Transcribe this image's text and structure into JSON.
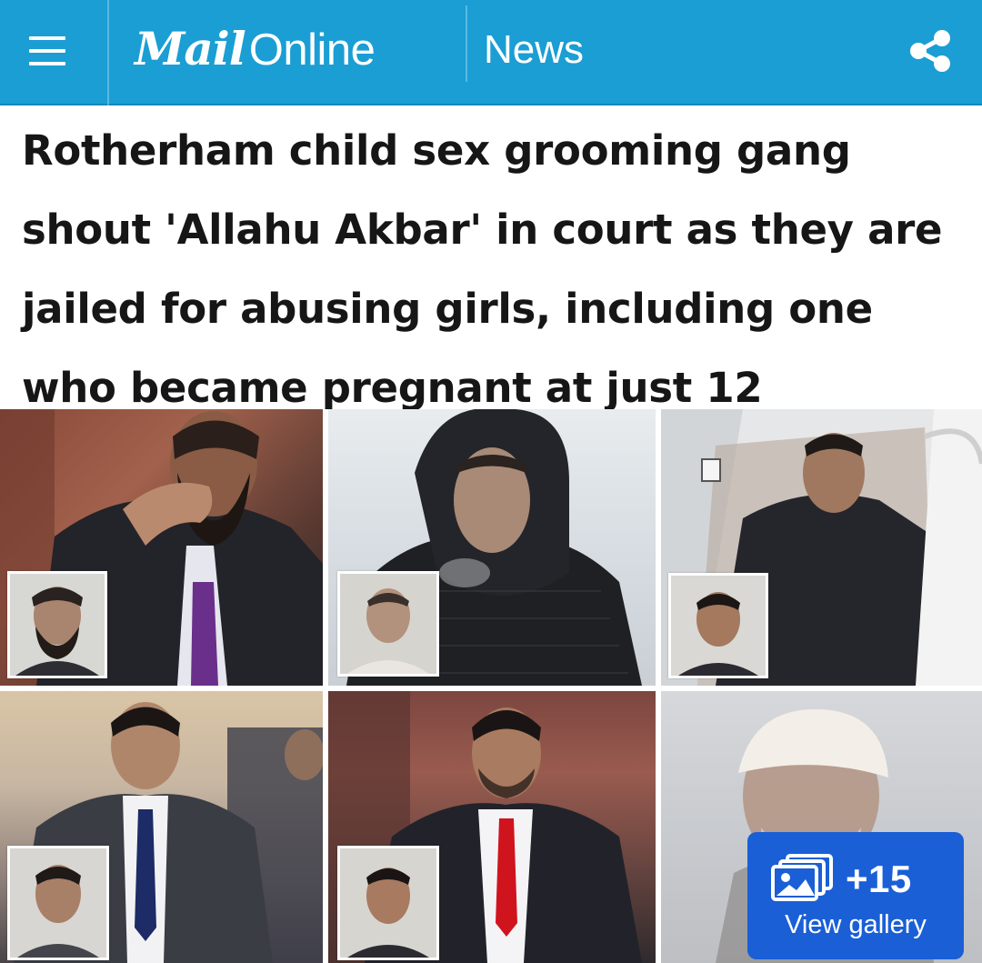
{
  "header": {
    "logo_mail": "Mail",
    "logo_online": "Online",
    "section": "News",
    "menu_icon": "hamburger-menu-icon",
    "share_icon": "share-icon",
    "background_color": "#1a9ed4"
  },
  "article": {
    "headline": "Rotherham child sex grooming gang shout 'Allahu Akbar' in court as they are jailed for abusing girls, including one who became pregnant at just 12"
  },
  "gallery": {
    "count": "+15",
    "label": "View gallery",
    "icon": "image-stack-icon",
    "button_color": "#1a5fd6"
  }
}
